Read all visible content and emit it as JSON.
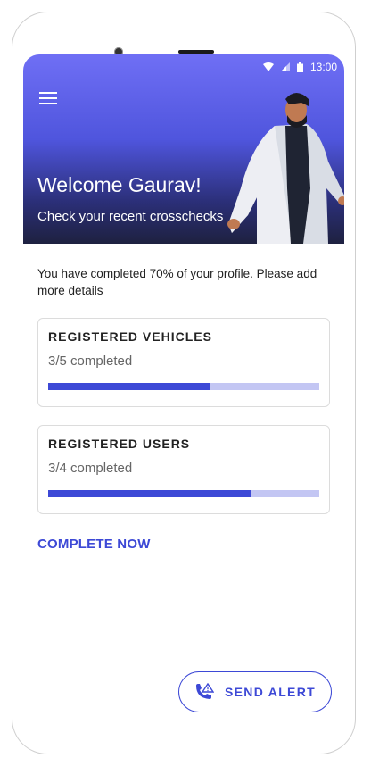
{
  "status_bar": {
    "time": "13:00",
    "icons": [
      "wifi-icon",
      "signal-icon",
      "battery-icon"
    ]
  },
  "header": {
    "menu_icon": "hamburger-menu-icon",
    "title": "Welcome Gaurav!",
    "subtitle": "Check your recent crosschecks"
  },
  "profile": {
    "message": "You have completed 70% of your profile. Please add more details",
    "completion_percent": 70
  },
  "cards": [
    {
      "title": "REGISTERED VEHICLES",
      "progress_text": "3/5 completed",
      "progress_fraction": 0.6
    },
    {
      "title": "REGISTERED USERS",
      "progress_text": "3/4 completed",
      "progress_fraction": 0.75
    }
  ],
  "actions": {
    "complete_now": "COMPLETE NOW",
    "send_alert": "SEND ALERT",
    "send_alert_icon": "phone-alert-icon"
  },
  "colors": {
    "accent": "#3d49d6",
    "track": "#c3c6f3",
    "hero_top": "#6f6ff5",
    "hero_bottom": "#1e2140"
  }
}
